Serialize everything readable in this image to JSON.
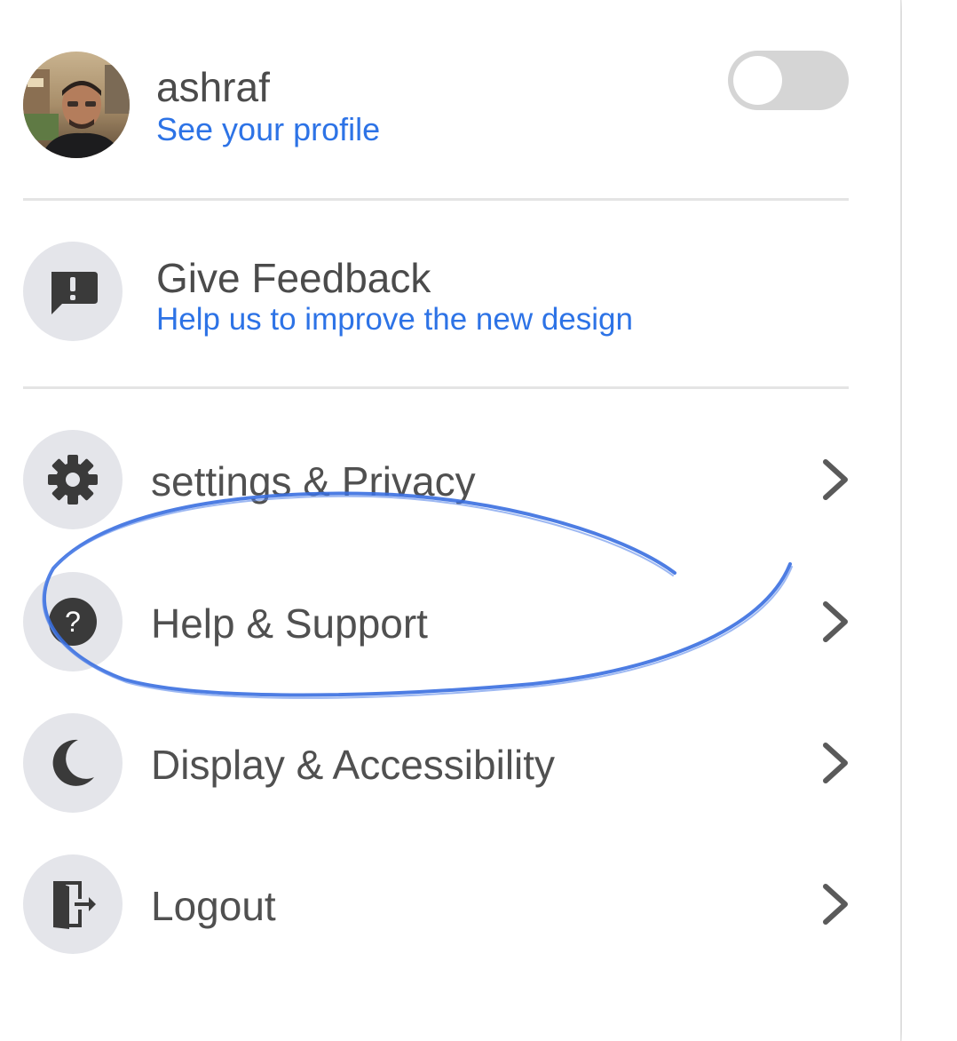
{
  "profile": {
    "name": "ashraf",
    "link_label": "See your profile",
    "avatar_icon": "user-photo-avatar"
  },
  "toggle": {
    "state": "off"
  },
  "feedback": {
    "title": "Give Feedback",
    "subtitle": "Help us to improve the new design",
    "icon": "feedback-exclamation-icon"
  },
  "menu": {
    "items": [
      {
        "label": "settings & Privacy",
        "icon": "gear-icon"
      },
      {
        "label": "Help & Support",
        "icon": "help-question-icon"
      },
      {
        "label": "Display & Accessibility",
        "icon": "moon-icon"
      },
      {
        "label": "Logout",
        "icon": "logout-door-icon"
      }
    ]
  },
  "colors": {
    "accent_link": "#2d73e6",
    "annotation_stroke": "#3a6fe0",
    "icon_bg": "#e4e5ea",
    "text": "#4b4b4b"
  }
}
